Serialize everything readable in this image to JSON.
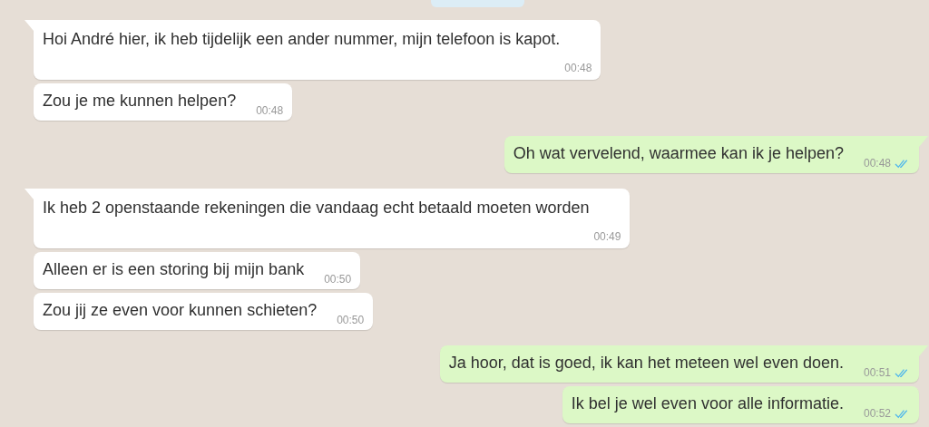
{
  "messages": [
    {
      "outgoing": false,
      "kind": "stacked",
      "tail": true,
      "text": "Hoi André hier, ik heb tijdelijk een ander nummer, mijn telefoon is kapot.",
      "time": "00:48"
    },
    {
      "outgoing": false,
      "kind": "inline",
      "tail": false,
      "text": "Zou je me kunnen helpen?",
      "time": "00:48"
    },
    {
      "outgoing": true,
      "kind": "inline",
      "tail": true,
      "text": "Oh wat vervelend, waarmee kan ik je helpen?",
      "time": "00:48",
      "read": true
    },
    {
      "outgoing": false,
      "kind": "stacked",
      "tail": true,
      "text": "Ik heb 2 openstaande rekeningen die vandaag echt betaald moeten worden",
      "time": "00:49"
    },
    {
      "outgoing": false,
      "kind": "inline",
      "tail": false,
      "text": "Alleen er is een storing bij mijn bank",
      "time": "00:50"
    },
    {
      "outgoing": false,
      "kind": "inline",
      "tail": false,
      "text": "Zou jij ze even voor kunnen schieten?",
      "time": "00:50"
    },
    {
      "outgoing": true,
      "kind": "inline",
      "tail": true,
      "text": "Ja hoor, dat is goed, ik kan het meteen wel even doen.",
      "time": "00:51",
      "read": true
    },
    {
      "outgoing": true,
      "kind": "inline",
      "tail": false,
      "text": "Ik bel je wel even voor alle informatie.",
      "time": "00:52",
      "read": true
    }
  ]
}
